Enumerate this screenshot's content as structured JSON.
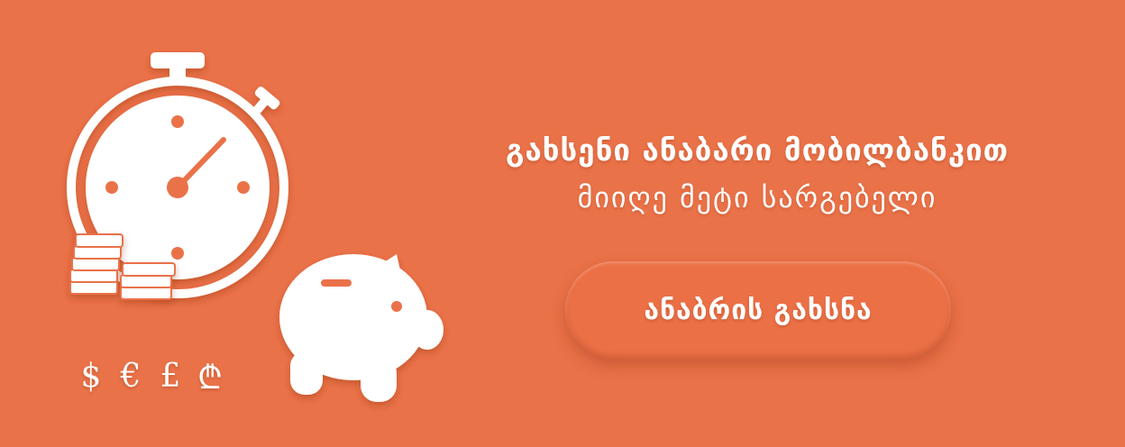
{
  "banner": {
    "headline": "გახსენი ანაბარი მობილბანკით",
    "subheadline": "მიიღე მეტი სარგებელი",
    "cta_label": "ანაბრის გახსნა",
    "background_color": "#ea7248"
  },
  "illustration": {
    "icons": [
      "stopwatch-icon",
      "coin-stack-icon",
      "piggy-bank-icon"
    ],
    "currency_symbols": [
      "$",
      "€",
      "£",
      "₾"
    ]
  }
}
